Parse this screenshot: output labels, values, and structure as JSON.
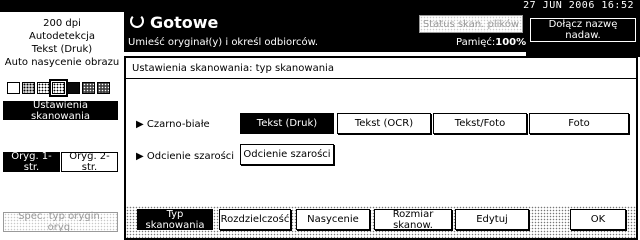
{
  "status_bar": {
    "date": "27  JUN   2006",
    "time": "16:52"
  },
  "left_panel": {
    "info_lines": [
      "200 dpi",
      "Autodetekcja",
      "Tekst (Druk)",
      "Auto nasycenie obrazu"
    ],
    "scan_settings_button": "Ustawienia skanowania",
    "original_1_side": "Oryg. 1-str.",
    "original_2_side": "Oryg. 2-str.",
    "special_original": "Spec. typ orygin. oryg."
  },
  "header": {
    "title": "Gotowe",
    "subtitle": "Umieść oryginał(y) i określ odbiorców.",
    "memory_label": "Pamięć:",
    "memory_value": "100%",
    "scan_status_button": "Status skan. plików",
    "attach_name_button": "Dołącz nazwę nadaw."
  },
  "dialog": {
    "title": "Ustawienia skanowania: typ skanowania",
    "rows": [
      {
        "label": "Czarno-białe",
        "options": [
          "Tekst (Druk)",
          "Tekst (OCR)",
          "Tekst/Foto",
          "Foto"
        ],
        "selected": 0
      },
      {
        "label": "Odcienie szarości",
        "options": [
          "Odcienie szarości"
        ],
        "selected": -1
      }
    ],
    "tabs": [
      "Typ skanowania",
      "Rozdzielczość",
      "Nasycenie",
      "Rozmiar skanow.",
      "Edytuj"
    ],
    "active_tab": 0,
    "ok_label": "OK"
  }
}
